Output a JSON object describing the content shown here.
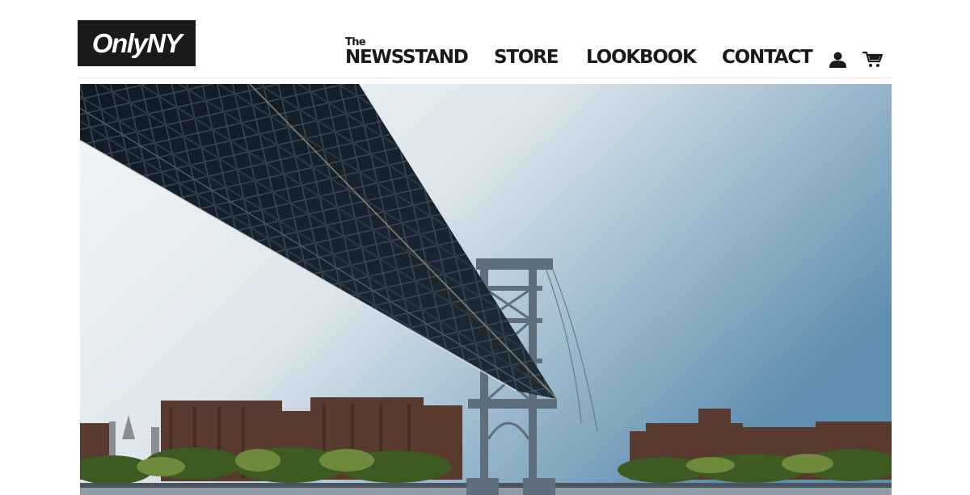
{
  "header": {
    "logo_text": "OnlyNY",
    "nav": {
      "newsstand_small": "The",
      "newsstand_main": "NEWSSTAND",
      "store": "STORE",
      "lookbook": "LOOKBOOK",
      "contact": "CONTACT"
    },
    "icons": [
      "account-icon",
      "cart-icon"
    ]
  },
  "colors": {
    "text": "#1a1a1a",
    "background": "#ffffff",
    "divider": "#e6e6e6",
    "sky_top": "#5f8fb0",
    "sky_bottom": "#eef2f5"
  }
}
